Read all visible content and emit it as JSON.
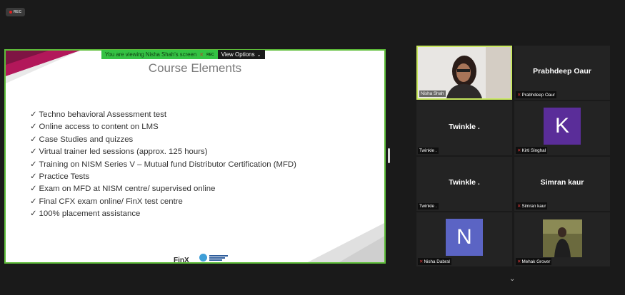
{
  "recording": {
    "badge": "REC"
  },
  "share_banner": {
    "viewing_text": "You are viewing Nisha Shah's screen",
    "rec_label": "REC",
    "view_options_label": "View Options"
  },
  "slide": {
    "title": "Course Elements",
    "bullets": [
      "Techno behavioral Assessment test",
      "Online access to content on LMS",
      "Case Studies and quizzes",
      "Virtual trainer led sessions (approx. 125 hours)",
      "Training on NISM Series V – Mutual fund Distributor Certification (MFD)",
      "Practice Tests",
      "Exam on MFD at NISM centre/ supervised online",
      "Final CFX exam online/ FinX test centre",
      "100% placement assistance"
    ],
    "check_glyph": "✓",
    "logo_text": "FinX",
    "colors": {
      "accent_magenta": "#b2175a",
      "accent_dark": "#8a1a4c",
      "border_active": "#5fbe3a"
    }
  },
  "participants": [
    {
      "name": "Nisha Shah",
      "type": "video",
      "muted": false,
      "active": true
    },
    {
      "name": "Prabhdeep Oaur",
      "display": "Prabhdeep Oaur",
      "type": "name",
      "muted": true
    },
    {
      "name": "Twinkle .",
      "display": "Twinkle .",
      "type": "name",
      "muted": false
    },
    {
      "name": "Kirti Singhal",
      "type": "avatar",
      "letter": "K",
      "avatar_color": "#5a2d99",
      "muted": true
    },
    {
      "name": "Twinkle .",
      "display": "Twinkle .",
      "type": "name",
      "muted": false
    },
    {
      "name": "Simran kaur",
      "display": "Simran kaur",
      "type": "name",
      "muted": true
    },
    {
      "name": "Nisha Dabral",
      "type": "avatar",
      "letter": "N",
      "avatar_color": "#5b64c4",
      "muted": true
    },
    {
      "name": "Mehak Grover",
      "type": "photo",
      "muted": true
    }
  ],
  "icons": {
    "mute": "mic-muted-icon",
    "down": "chevron-down-icon"
  },
  "chevron_glyph": "⌄",
  "mute_glyph": "✕"
}
